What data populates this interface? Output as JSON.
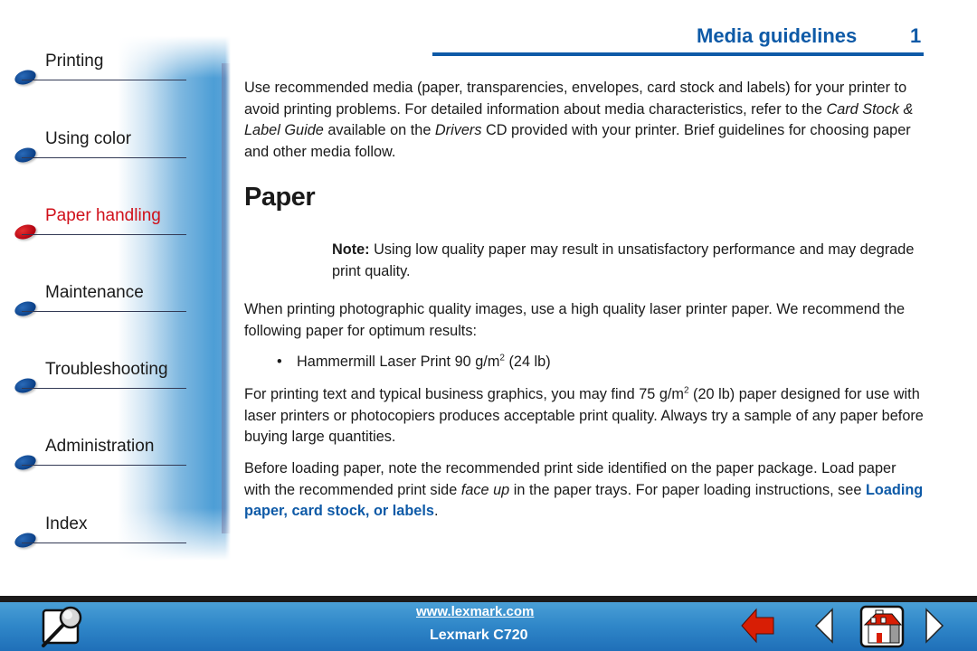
{
  "sidebar": {
    "items": [
      {
        "label": "Printing",
        "active": false
      },
      {
        "label": "Using color",
        "active": false
      },
      {
        "label": "Paper handling",
        "active": true
      },
      {
        "label": "Maintenance",
        "active": false
      },
      {
        "label": "Troubleshooting",
        "active": false
      },
      {
        "label": "Administration",
        "active": false
      },
      {
        "label": "Index",
        "active": false
      }
    ]
  },
  "header": {
    "title": "Media guidelines",
    "page_number": "1"
  },
  "content": {
    "intro": {
      "text_before_guide": "Use recommended media (paper, transparencies, envelopes, card stock and labels) for your printer to avoid printing problems. For detailed information about media characteristics, refer to the ",
      "guide_title": "Card Stock & Label Guide",
      "text_mid": " available on the ",
      "cd_name": "Drivers",
      "text_after": " CD provided with your printer. Brief guidelines for choosing paper and other media follow."
    },
    "heading": "Paper",
    "note": {
      "label": "Note:",
      "text": " Using low quality paper may result in unsatisfactory performance and may degrade print quality."
    },
    "photo_paragraph": "When printing photographic quality images, use a high quality laser printer paper. We recommend the following paper for optimum results:",
    "bullet": {
      "symbol": "•",
      "text_before_sup": "Hammermill Laser Print 90 g/m",
      "sup": "2",
      "text_after_sup": " (24 lb)"
    },
    "business_paragraph": {
      "text_before_sup": "For printing text and typical business graphics, you may find 75 g/m",
      "sup": "2",
      "text_after_sup": " (20 lb) paper designed for use with laser printers or photocopiers produces acceptable print quality. Always try a sample of any paper before buying large quantities."
    },
    "loading_paragraph": {
      "text_before_em": "Before loading paper, note the recommended print side identified on the paper package. Load paper with the recommended print side ",
      "em": "face up",
      "text_mid": " in the paper trays. For paper loading instructions, see ",
      "link": "Loading paper, card stock, or labels",
      "text_end": "."
    }
  },
  "footer": {
    "url": "www.lexmark.com",
    "model": "Lexmark C720",
    "buttons": {
      "search": "search-icon",
      "back": "back-arrow-icon",
      "previous": "previous-page-icon",
      "home": "home-icon",
      "next": "next-page-icon"
    },
    "colors": {
      "bar": "#2f86c8",
      "back_arrow": "#d81e05"
    }
  },
  "colors": {
    "accent": "#0e5aa7",
    "active_nav": "#d0101a"
  }
}
